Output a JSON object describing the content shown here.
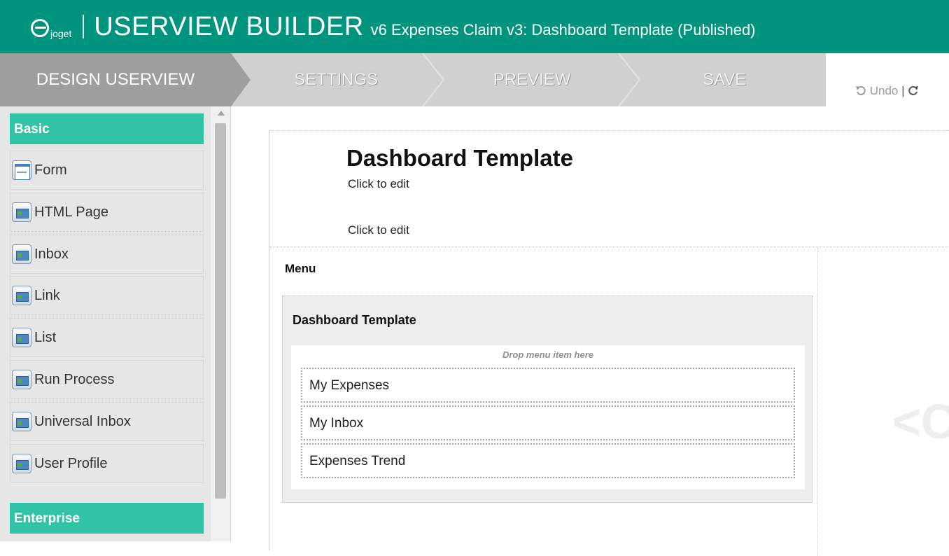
{
  "header": {
    "logo_text": "joget",
    "title": "USERVIEW BUILDER",
    "subtitle": "v6 Expenses Claim v3: Dashboard Template (Published)",
    "bg_color": "#00937e"
  },
  "tabs": [
    {
      "label": "DESIGN USERVIEW",
      "active": true
    },
    {
      "label": "SETTINGS",
      "active": false
    },
    {
      "label": "PREVIEW",
      "active": false
    },
    {
      "label": "SAVE",
      "active": false
    }
  ],
  "toolbar": {
    "undo_label": "Undo",
    "separator": "|",
    "undo_icon": "undo-icon",
    "redo_icon": "redo-icon"
  },
  "sidebar": {
    "sections": [
      {
        "title": "Basic",
        "items": [
          {
            "label": "Form",
            "icon": "form-icon"
          },
          {
            "label": "HTML Page",
            "icon": "element-icon"
          },
          {
            "label": "Inbox",
            "icon": "element-icon"
          },
          {
            "label": "Link",
            "icon": "element-icon"
          },
          {
            "label": "List",
            "icon": "element-icon"
          },
          {
            "label": "Run Process",
            "icon": "element-icon"
          },
          {
            "label": "Universal Inbox",
            "icon": "element-icon"
          },
          {
            "label": "User Profile",
            "icon": "element-icon"
          }
        ]
      },
      {
        "title": "Enterprise",
        "items": []
      }
    ],
    "accent_color": "#31c3a5"
  },
  "canvas": {
    "page_title": "Dashboard Template",
    "click_to_edit_1": "Click to edit",
    "click_to_edit_2": "Click to edit",
    "menu_label": "Menu",
    "category_title": "Dashboard Template",
    "drop_hint": "Drop menu item here",
    "menu_items": [
      {
        "label": "My Expenses"
      },
      {
        "label": "My Inbox"
      },
      {
        "label": "Expenses Trend"
      }
    ],
    "ghost_text": "<C"
  }
}
